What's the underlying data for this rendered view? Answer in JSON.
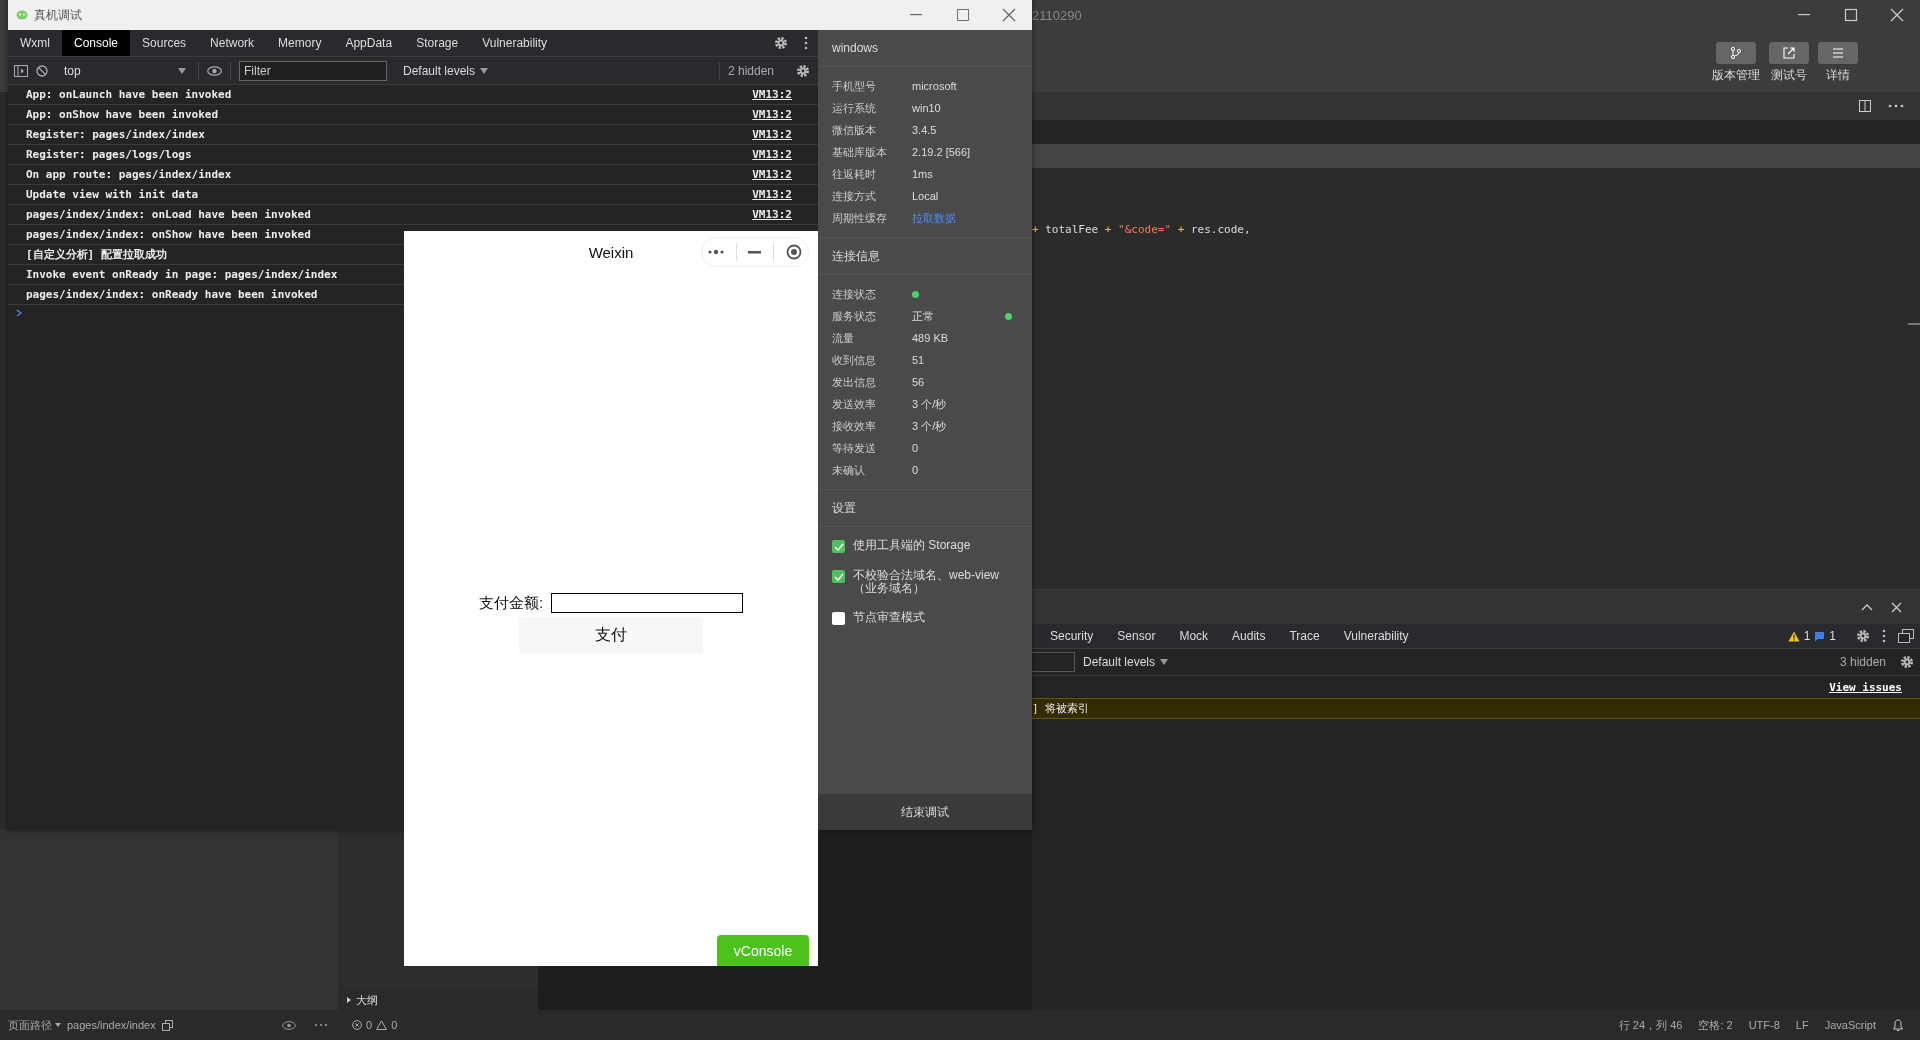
{
  "ide": {
    "title": "2110290",
    "toolbar": [
      {
        "kind": "branch",
        "label": "版本管理"
      },
      {
        "kind": "external",
        "label": "测试号"
      },
      {
        "kind": "menu",
        "label": "详情"
      }
    ],
    "code": [
      {
        "kind": "op",
        "text": "+"
      },
      {
        "kind": "ident",
        "text": " totalFee "
      },
      {
        "kind": "op",
        "text": "+"
      },
      {
        "kind": "str",
        "text": " \"&code=\""
      },
      {
        "kind": "op",
        "text": " +"
      },
      {
        "kind": "ident",
        "text": " res.code,"
      }
    ],
    "debugger": {
      "tabs": [
        {
          "label": "Security",
          "selected": false
        },
        {
          "label": "Sensor",
          "selected": false
        },
        {
          "label": "Mock",
          "selected": false
        },
        {
          "label": "Audits",
          "selected": false
        },
        {
          "label": "Trace",
          "selected": false
        },
        {
          "label": "Vulnerability",
          "selected": false
        }
      ],
      "warnings": "1",
      "messages": "1",
      "levels": "Default levels",
      "hidden": "3 hidden",
      "view_issues": "View issues",
      "message": "] 将被索引"
    },
    "outline": "大纲",
    "status_bar": {
      "path_label": "页面路径",
      "path": "pages/index/index",
      "errors": "0",
      "warnings": "0",
      "position": "行 24，列 46",
      "spaces": "空格: 2",
      "encoding": "UTF-8",
      "eol": "LF",
      "language": "JavaScript"
    }
  },
  "debug_window": {
    "title": "真机调试",
    "tabs": [
      {
        "label": "Wxml",
        "selected": false
      },
      {
        "label": "Console",
        "selected": true
      },
      {
        "label": "Sources",
        "selected": false
      },
      {
        "label": "Network",
        "selected": false
      },
      {
        "label": "Memory",
        "selected": false
      },
      {
        "label": "AppData",
        "selected": false
      },
      {
        "label": "Storage",
        "selected": false
      },
      {
        "label": "Vulnerability",
        "selected": false
      }
    ],
    "context": "top",
    "filter_placeholder": "Filter",
    "levels": "Default levels",
    "hidden": "2 hidden",
    "console": [
      {
        "text": "App: onLaunch have been invoked",
        "source": "VM13:2"
      },
      {
        "text": "App: onShow have been invoked",
        "source": "VM13:2"
      },
      {
        "text": "Register: pages/index/index",
        "source": "VM13:2"
      },
      {
        "text": "Register: pages/logs/logs",
        "source": "VM13:2"
      },
      {
        "text": "On app route: pages/index/index",
        "source": "VM13:2"
      },
      {
        "text": "Update view with init data",
        "source": "VM13:2"
      },
      {
        "text": "pages/index/index: onLoad have been invoked",
        "source": "VM13:2"
      },
      {
        "text": "pages/index/index: onShow have been invoked"
      },
      {
        "text": "[自定义分析] 配置拉取成功"
      },
      {
        "text": "Invoke event onReady in page: pages/index/index"
      },
      {
        "text": "pages/index/index: onReady have been invoked"
      }
    ],
    "info": {
      "device": "windows",
      "basic": [
        {
          "label": "手机型号",
          "value": "microsoft",
          "kind": "text"
        },
        {
          "label": "运行系统",
          "value": "win10",
          "kind": "text"
        },
        {
          "label": "微信版本",
          "value": "3.4.5",
          "kind": "text"
        },
        {
          "label": "基础库版本",
          "value": "2.19.2 [566]",
          "kind": "text"
        },
        {
          "label": "往返耗时",
          "value": "1ms",
          "kind": "text"
        },
        {
          "label": "连接方式",
          "value": "Local",
          "kind": "text"
        },
        {
          "label": "周期性缓存",
          "value": "拉取数据",
          "kind": "link"
        }
      ],
      "connection_title": "连接信息",
      "connection": [
        {
          "label": "连接状态",
          "online": true
        },
        {
          "label": "服务状态",
          "value": "正常",
          "online": true
        },
        {
          "label": "流量",
          "value": "489 KB"
        },
        {
          "label": "收到信息",
          "value": "51"
        },
        {
          "label": "发出信息",
          "value": "56"
        },
        {
          "label": "发送效率",
          "value": "3 个/秒"
        },
        {
          "label": "接收效率",
          "value": "3 个/秒"
        },
        {
          "label": "等待发送",
          "value": "0"
        },
        {
          "label": "未确认",
          "value": "0"
        }
      ],
      "settings_title": "设置",
      "settings": [
        {
          "label": "使用工具端的 Storage",
          "checked": true
        },
        {
          "label": "不校验合法域名、web-view（业务域名）",
          "checked": true
        },
        {
          "label": "节点审查模式",
          "checked": false
        }
      ],
      "end_button": "结束调试"
    }
  },
  "simulator": {
    "title": "Weixin",
    "amount_label": "支付金额:",
    "pay_button": "支付",
    "vconsole": "vConsole"
  }
}
